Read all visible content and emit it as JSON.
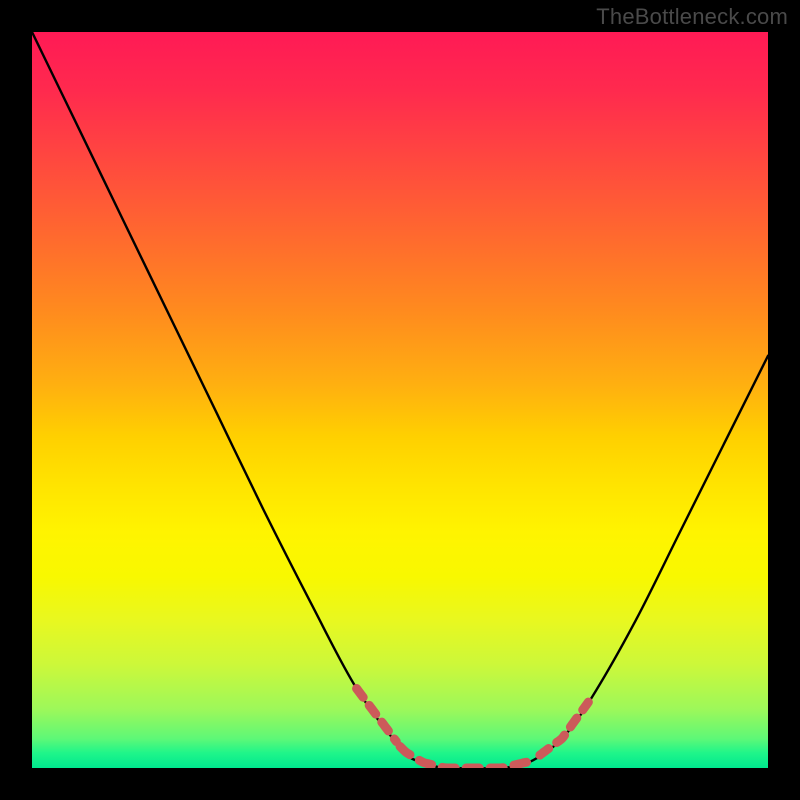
{
  "watermark": "TheBottleneck.com",
  "chart_data": {
    "type": "line",
    "title": "",
    "xlabel": "",
    "ylabel": "",
    "xlim": [
      0,
      1
    ],
    "ylim": [
      0,
      1
    ],
    "series": [
      {
        "name": "curve",
        "x": [
          0.0,
          0.063,
          0.126,
          0.189,
          0.252,
          0.315,
          0.378,
          0.441,
          0.504,
          0.53,
          0.56,
          0.6,
          0.64,
          0.68,
          0.72,
          0.76,
          0.82,
          0.88,
          0.94,
          1.0
        ],
        "y": [
          1.0,
          0.87,
          0.74,
          0.61,
          0.48,
          0.35,
          0.226,
          0.108,
          0.024,
          0.008,
          0.0,
          0.0,
          0.0,
          0.01,
          0.04,
          0.095,
          0.2,
          0.32,
          0.44,
          0.56
        ]
      }
    ],
    "dotted_segments": [
      {
        "x_start": 0.441,
        "x_end": 0.5
      },
      {
        "x_start": 0.5,
        "x_end": 0.69
      },
      {
        "x_start": 0.69,
        "x_end": 0.76
      }
    ]
  },
  "colors": {
    "curve_stroke": "#000000",
    "dotted_stroke": "#cc5a5a",
    "background_black": "#000000"
  }
}
